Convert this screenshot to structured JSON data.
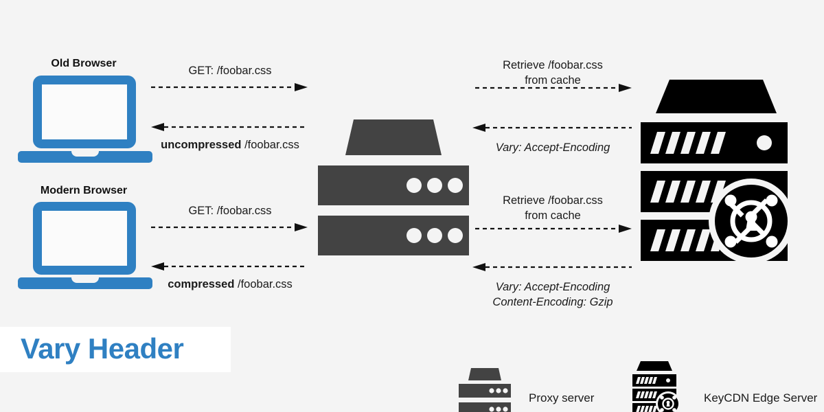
{
  "meta": {
    "title": "Vary Header",
    "background_color": "#f4f4f4",
    "accent_color": "#2f80c2",
    "proxy_color": "#434343",
    "edge_color": "#000000",
    "text_color": "#1a1a1a"
  },
  "nodes": {
    "old_browser": {
      "label": "Old Browser",
      "icon": "laptop-icon"
    },
    "modern_browser": {
      "label": "Modern Browser",
      "icon": "laptop-icon"
    },
    "proxy_server": {
      "icon": "proxy-server-icon"
    },
    "edge_server": {
      "icon": "keycdn-edge-server-icon"
    }
  },
  "flows": {
    "old_request": {
      "text": "GET: /foobar.css",
      "direction": "right"
    },
    "old_response": {
      "bold": "uncompressed",
      "rest": " /foobar.css",
      "direction": "left"
    },
    "modern_request": {
      "text": "GET: /foobar.css",
      "direction": "right"
    },
    "modern_response": {
      "bold": "compressed",
      "rest": " /foobar.css",
      "direction": "left"
    },
    "proxy_to_edge_top": {
      "line1": "Retrieve /foobar.css",
      "line2": "from cache",
      "direction": "right"
    },
    "edge_to_proxy_top": {
      "line1": "Vary: Accept-Encoding",
      "direction": "left"
    },
    "proxy_to_edge_bottom": {
      "line1": "Retrieve /foobar.css",
      "line2": "from cache",
      "direction": "right"
    },
    "edge_to_proxy_bottom": {
      "line1": "Vary: Accept-Encoding",
      "line2": "Content-Encoding: Gzip",
      "direction": "left"
    }
  },
  "legend": {
    "items": [
      {
        "label": "Proxy server",
        "icon": "proxy-server-icon"
      },
      {
        "label": "KeyCDN Edge Server",
        "icon": "keycdn-edge-server-icon"
      }
    ]
  }
}
